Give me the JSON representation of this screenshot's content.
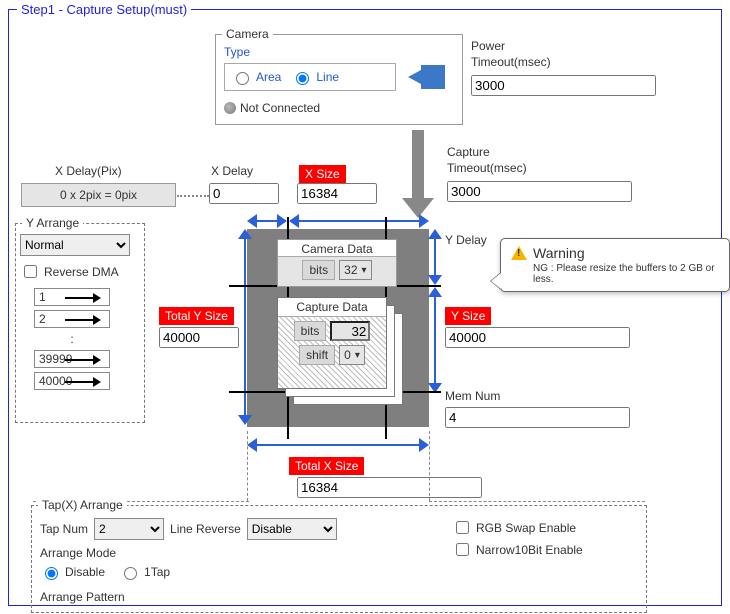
{
  "step_title": "Step1 - Capture Setup(must)",
  "camera": {
    "legend": "Camera",
    "type_label": "Type",
    "area": "Area",
    "line": "Line",
    "not_connected": "Not Connected"
  },
  "power_timeout": {
    "label1": "Power",
    "label2": "Timeout(msec)",
    "value": "3000"
  },
  "capture_timeout": {
    "label1": "Capture",
    "label2": "Timeout(msec)",
    "value": "3000"
  },
  "xdelay_pix": {
    "label": "X Delay(Pix)",
    "expr": "0 x 2pix = 0pix"
  },
  "xdelay": {
    "label": "X Delay",
    "value": "0"
  },
  "xsize": {
    "label": "X Size",
    "value": "16384"
  },
  "yarrange": {
    "legend": "Y Arrange",
    "mode": "Normal",
    "reverse_dma": "Reverse DMA",
    "rows": [
      "1",
      "2",
      "39999",
      "40000"
    ],
    "ellipsis": ":"
  },
  "total_y": {
    "label": "Total Y Size",
    "value": "40000"
  },
  "camera_data": {
    "label": "Camera Data",
    "bits_label": "bits",
    "bits_value": "32"
  },
  "capture_data": {
    "label": "Capture Data",
    "bits_label": "bits",
    "bits_value": "32",
    "shift_label": "shift",
    "shift_value": "0"
  },
  "ydelay": {
    "label": "Y Delay"
  },
  "ysize": {
    "label": "Y Size",
    "value": "40000"
  },
  "memnum": {
    "label": "Mem Num",
    "value": "4"
  },
  "total_x": {
    "label": "Total X Size",
    "value": "16384"
  },
  "tapx": {
    "legend": "Tap(X) Arrange",
    "tap_num_label": "Tap Num",
    "tap_num_value": "2",
    "line_reverse_label": "Line Reverse",
    "line_reverse_value": "Disable",
    "arrange_mode_label": "Arrange Mode",
    "disable": "Disable",
    "one_tap": "1Tap",
    "arrange_pattern_label": "Arrange Pattern",
    "rgb_swap": "RGB Swap Enable",
    "narrow10": "Narrow10Bit Enable"
  },
  "tooltip": {
    "title": "Warning",
    "body": "NG : Please resize the buffers to 2 GB or less."
  }
}
